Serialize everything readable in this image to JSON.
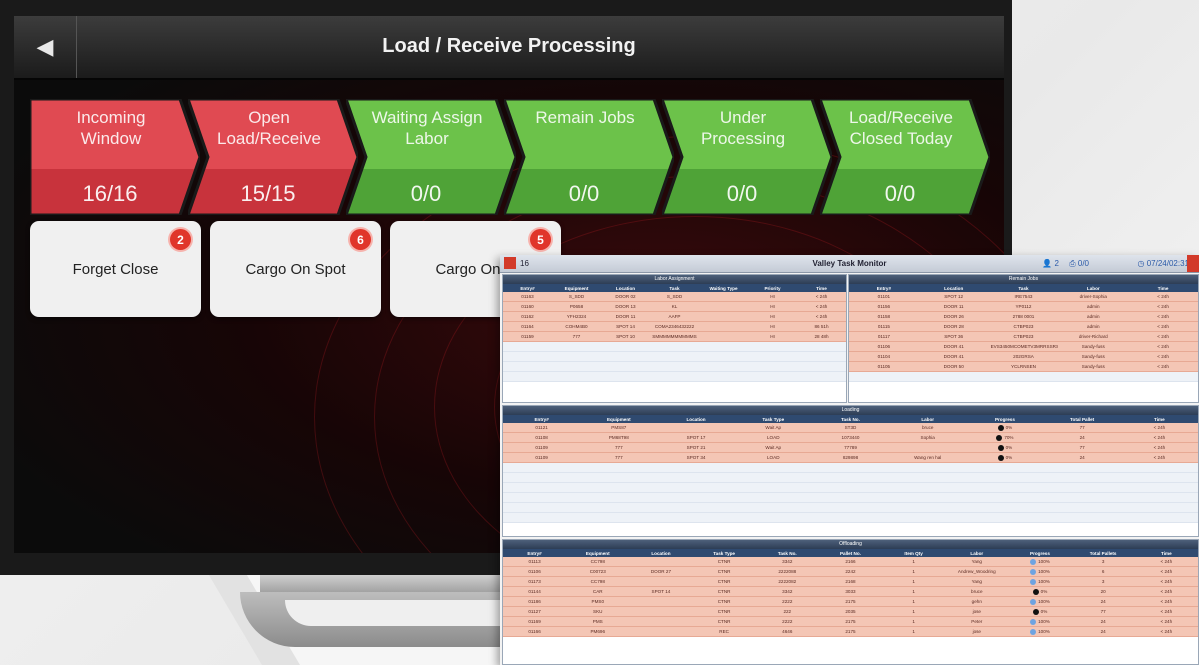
{
  "screen": {
    "title": "Load / Receive Processing",
    "back_icon": "◀",
    "steps": [
      {
        "label": "Incoming Window",
        "count": "16/16",
        "color": "#e04a52",
        "dark": "#c8333c"
      },
      {
        "label": "Open Load/Receive",
        "count": "15/15",
        "color": "#e04a52",
        "dark": "#c8333c"
      },
      {
        "label": "Waiting Assign Labor",
        "count": "0/0",
        "color": "#6cc24a",
        "dark": "#4fa337"
      },
      {
        "label": "Remain Jobs",
        "count": "0/0",
        "color": "#6cc24a",
        "dark": "#4fa337"
      },
      {
        "label": "Under Processing",
        "count": "0/0",
        "color": "#6cc24a",
        "dark": "#4fa337"
      },
      {
        "label": "Load/Receive Closed Today",
        "count": "0/0",
        "color": "#6cc24a",
        "dark": "#4fa337"
      }
    ],
    "cards": [
      {
        "label": "Forget Close",
        "badge": "2"
      },
      {
        "label": "Cargo On Spot",
        "badge": "6"
      },
      {
        "label": "Cargo On D",
        "badge": "5"
      }
    ]
  },
  "tablet": {
    "title": "Valley Task Monitor",
    "top_left_num": "16",
    "user_count": "2",
    "printer": "0/0",
    "clock": "07/24/02:31",
    "labor_panel": {
      "headers": [
        "Entry#",
        "Equipment",
        "Location",
        "Task",
        "Waiting Type",
        "Priority",
        "Time"
      ],
      "rows": [
        [
          "01163",
          "S_SDD",
          "DOOR 02",
          "S_SDD",
          "",
          "HI",
          "< 24h"
        ],
        [
          "01160",
          "P0658",
          "DOOR 13",
          "KL",
          "",
          "HI",
          "< 24h"
        ],
        [
          "01162",
          "YFH2324",
          "DOOR 11",
          "AAFP",
          "",
          "HI",
          "< 24h"
        ],
        [
          "01164",
          "COHM4B0",
          "SPOT 14",
          "COMA2346432222",
          "",
          "HI",
          "86 51h"
        ],
        [
          "01159",
          "777",
          "SPOT 10",
          "SMMMMMMMMMMS",
          "",
          "HI",
          "28 48h"
        ]
      ]
    },
    "remain_panel": {
      "headers": [
        "Entry#",
        "Location",
        "Task",
        "Labor",
        "Time"
      ],
      "rows": [
        [
          "01101",
          "SPOT 12",
          "IRE7543",
          "driver-Sophia",
          "< 24h"
        ],
        [
          "01156",
          "DOOR 11",
          "YP0112",
          "admin",
          "< 24h"
        ],
        [
          "01158",
          "DOOR 26",
          "2788 0001",
          "admin",
          "< 24h"
        ],
        [
          "01115",
          "DOOR 28",
          "CTBP023",
          "admin",
          "< 24h"
        ],
        [
          "01117",
          "SPOT 36",
          "CTBP023",
          "driver-Richard",
          "< 24h"
        ],
        [
          "01106",
          "DOOR 41",
          "EVS3450MCOMETV3MRRSSRS",
          "Sandy-fuss",
          "< 24h"
        ],
        [
          "01104",
          "DOOR 41",
          "202GRSA",
          "Sandy-fuss",
          "< 24h"
        ],
        [
          "01105",
          "DOOR 50",
          "YCLRNSEN",
          "Sandy-fuss",
          "< 24h"
        ]
      ]
    },
    "loading_panel": {
      "headers": [
        "Entry#",
        "Equipment",
        "Location",
        "Task Type",
        "Task No.",
        "Labor",
        "Progress",
        "Total Pallet",
        "Time"
      ],
      "rows": [
        [
          "01121",
          "PMS87",
          "",
          "Wait Ap",
          "ST3D",
          "bruce",
          "0%",
          "77",
          "< 24h"
        ],
        [
          "01108",
          "PM68T98",
          "SPOT 17",
          "LOAD",
          "1073440",
          "Sophia",
          "70%",
          "24",
          "< 24h"
        ],
        [
          "01109",
          "777",
          "SPOT 21",
          "Wait Ap",
          "77789",
          "",
          "0%",
          "77",
          "< 24h"
        ],
        [
          "01109",
          "777",
          "SPOT 34",
          "LOAD",
          "829898",
          "Wang ren hal",
          "0%",
          "24",
          "< 24h"
        ]
      ]
    },
    "offloading_panel": {
      "headers": [
        "Entry#",
        "Equipment",
        "Location",
        "Task Type",
        "Task No.",
        "Pallet No.",
        "Item Qty",
        "Labor",
        "Progress",
        "Total Pallets",
        "Time"
      ],
      "rows": [
        [
          "01113",
          "CC798",
          "",
          "CTNR",
          "3342",
          "2166",
          "1",
          "Yang",
          "100%",
          "3",
          "< 24h"
        ],
        [
          "01106",
          "C00723",
          "DOOR 27",
          "CTNR",
          "2222088",
          "2242",
          "1",
          "Andrew_Woodring",
          "100%",
          "6",
          "< 24h"
        ],
        [
          "01173",
          "CC798",
          "",
          "CTNR",
          "2222082",
          "2168",
          "1",
          "Yang",
          "100%",
          "3",
          "< 24h"
        ],
        [
          "01144",
          "CAR",
          "SPOT 14",
          "CTNR",
          "3342",
          "3033",
          "1",
          "bruce",
          "0%",
          "20",
          "< 24h"
        ],
        [
          "01186",
          "PMS0",
          "",
          "CTNR",
          "2222",
          "2175",
          "1",
          "gehn",
          "100%",
          "24",
          "< 24h"
        ],
        [
          "01127",
          "SKU",
          "",
          "CTNR",
          "222",
          "2035",
          "1",
          "jose",
          "0%",
          "77",
          "< 24h"
        ],
        [
          "01169",
          "PMS",
          "",
          "CTNR",
          "2222",
          "2175",
          "1",
          "Peter",
          "100%",
          "24",
          "< 24h"
        ],
        [
          "01166",
          "PM696",
          "",
          "REC",
          "4646",
          "2175",
          "1",
          "jose",
          "100%",
          "24",
          "< 24h"
        ]
      ]
    }
  }
}
